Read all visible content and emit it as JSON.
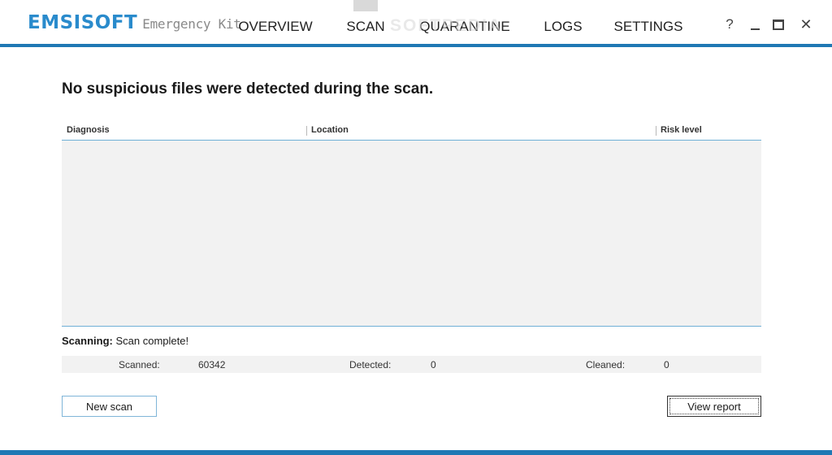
{
  "app": {
    "brand": "EMSISOFT",
    "product": "Emergency Kit"
  },
  "nav": {
    "items": [
      {
        "label": "OVERVIEW",
        "active": false
      },
      {
        "label": "SCAN",
        "active": true
      },
      {
        "label": "QUARANTINE",
        "active": false
      },
      {
        "label": "LOGS",
        "active": false
      },
      {
        "label": "SETTINGS",
        "active": false
      }
    ]
  },
  "watermark": "SOFTPEDIA",
  "window_controls": {
    "help": "?",
    "close": "✕",
    "minimize_icon": "minimize-icon",
    "maximize_icon": "maximize-icon"
  },
  "main": {
    "heading": "No suspicious files were detected during the scan.",
    "table": {
      "columns": [
        "Diagnosis",
        "Location",
        "Risk level"
      ],
      "rows": []
    },
    "status": {
      "label": "Scanning:",
      "value": "Scan complete!"
    },
    "stats": {
      "scanned_label": "Scanned:",
      "scanned_value": "60342",
      "detected_label": "Detected:",
      "detected_value": "0",
      "cleaned_label": "Cleaned:",
      "cleaned_value": "0"
    },
    "buttons": {
      "new_scan": "New scan",
      "view_report": "View report"
    }
  },
  "colors": {
    "accent": "#1f78b4",
    "brand": "#2a8bcc",
    "panel": "#f2f2f2"
  }
}
